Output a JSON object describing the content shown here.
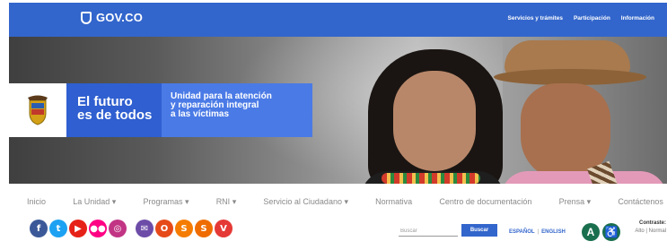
{
  "header": {
    "logo_text": "GOV.CO",
    "links": [
      "Servicios y trámites",
      "Participación",
      "Información"
    ],
    "brand_color": "#3366cc"
  },
  "hero": {
    "slogan_line1": "El futuro",
    "slogan_line2": "es de todos",
    "unit_line1": "Unidad para la atención",
    "unit_line2": "y reparación integral",
    "unit_line3": "a las víctimas",
    "crest_icon": "coat-of-arms-icon"
  },
  "nav": {
    "items": [
      "Inicio",
      "La Unidad ▾",
      "Programas ▾",
      "RNI ▾",
      "Servicio al Ciudadano ▾",
      "Normativa",
      "Centro de documentación",
      "Prensa ▾",
      "Contáctenos"
    ]
  },
  "social": [
    {
      "icon": "facebook-icon",
      "glyph": "f",
      "color": "#3b5998"
    },
    {
      "icon": "twitter-icon",
      "glyph": "t",
      "color": "#1da1f2"
    },
    {
      "icon": "youtube-icon",
      "glyph": "▶",
      "color": "#e62117"
    },
    {
      "icon": "flickr-icon",
      "glyph": "●●",
      "color": "#ff0084"
    },
    {
      "icon": "instagram-icon",
      "glyph": "◎",
      "color": "#c13584"
    },
    {
      "icon": "email-icon",
      "glyph": "✉",
      "color": "#6d4ca8"
    },
    {
      "icon": "outlook-icon",
      "glyph": "O",
      "color": "#e64a19"
    },
    {
      "icon": "skype-icon",
      "glyph": "S",
      "color": "#f57c00"
    },
    {
      "icon": "spotify-icon",
      "glyph": "S",
      "color": "#ef6c00"
    },
    {
      "icon": "vive-icon",
      "glyph": "V",
      "color": "#e53935"
    }
  ],
  "search": {
    "placeholder": "Buscar",
    "button_label": "Buscar"
  },
  "language": {
    "es": "ESPAÑOL",
    "en": "ENGLISH"
  },
  "accessibility": {
    "a_label": "A",
    "person_label": "♿",
    "contrast_title": "Contraste:",
    "contrast_alto": "Alto",
    "contrast_normal": "Normal"
  }
}
